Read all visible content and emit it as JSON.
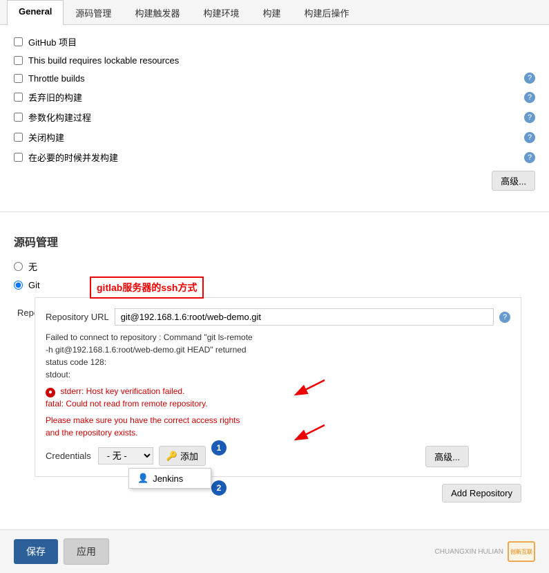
{
  "tabs": [
    {
      "label": "General",
      "active": true
    },
    {
      "label": "源码管理",
      "active": false
    },
    {
      "label": "构建触发器",
      "active": false
    },
    {
      "label": "构建环境",
      "active": false
    },
    {
      "label": "构建",
      "active": false
    },
    {
      "label": "构建后操作",
      "active": false
    }
  ],
  "general": {
    "checkboxes": [
      {
        "label": "GitHub 项目",
        "checked": false
      },
      {
        "label": "This build requires lockable resources",
        "checked": false
      },
      {
        "label": "Throttle builds",
        "checked": false
      },
      {
        "label": "丢弃旧的构建",
        "checked": false
      },
      {
        "label": "参数化构建过程",
        "checked": false
      },
      {
        "label": "关闭构建",
        "checked": false
      },
      {
        "label": "在必要的时候并发构建",
        "checked": false
      }
    ],
    "advanced_btn": "高级...",
    "help_icons": [
      true,
      false,
      true,
      true,
      true,
      true,
      true
    ]
  },
  "source_mgmt": {
    "title": "源码管理",
    "options": [
      {
        "label": "无",
        "value": "none"
      },
      {
        "label": "Git",
        "value": "git"
      }
    ],
    "selected": "git",
    "repositories_label": "Repositories",
    "annotation": {
      "label": "gitlab服务器的ssh方式"
    },
    "repo_url_label": "Repository URL",
    "repo_url_value": "git@192.168.1.6:root/web-demo.git",
    "error": {
      "line1": "Failed to connect to repository : Command \"git ls-remote",
      "line2": "-h git@192.168.1.6:root/web-demo.git HEAD\" returned",
      "line3": "status code 128:",
      "line4": "stdout:",
      "line5": "stderr: Host key verification failed.",
      "line6": "fatal: Could not read from remote repository.",
      "line7": "",
      "line8": "Please make sure you have the correct access rights",
      "line9": "and the repository exists."
    },
    "credentials_label": "Credentials",
    "credentials_select": "- 无 -",
    "add_btn": "添加",
    "dropdown_item": "Jenkins",
    "advanced_btn": "高级...",
    "add_repo_btn": "Add Repository"
  },
  "bottom": {
    "save_label": "保存",
    "apply_label": "应用"
  },
  "watermark": {
    "line1": "创新互联",
    "line2": "CHUANGXIN HULIAN"
  }
}
